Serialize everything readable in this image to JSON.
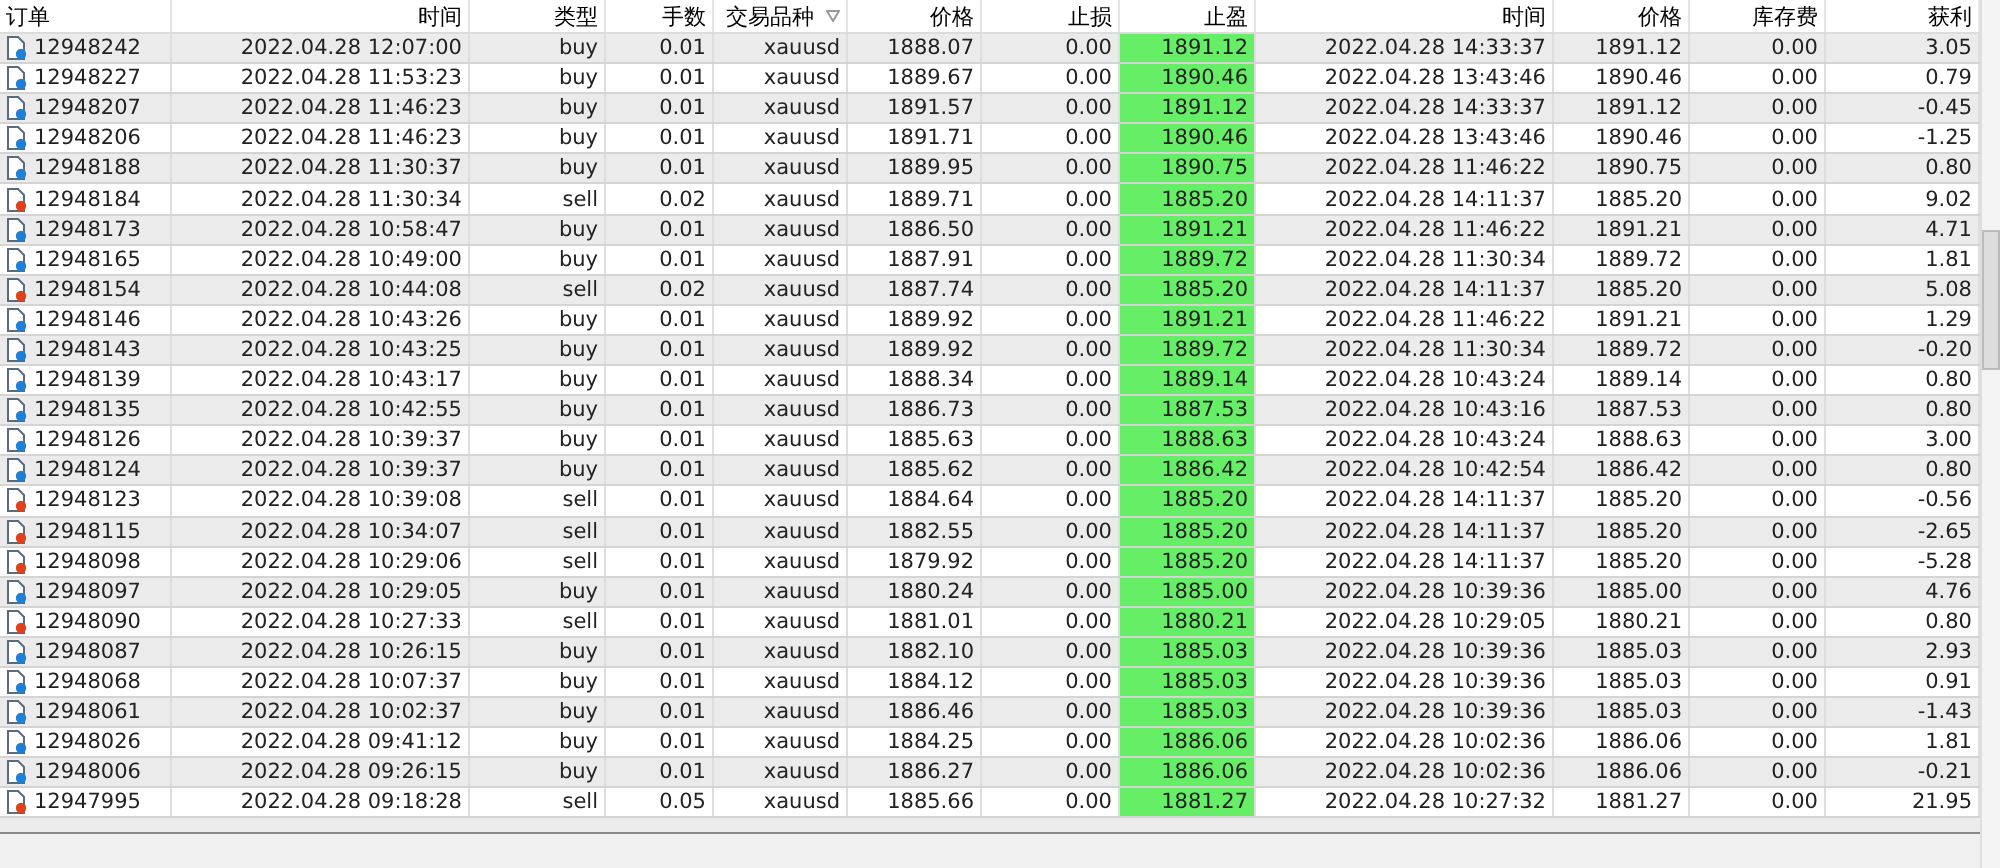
{
  "table": {
    "columns": [
      {
        "label": "订单",
        "sorted": false
      },
      {
        "label": "时间",
        "sorted": false
      },
      {
        "label": "类型",
        "sorted": false
      },
      {
        "label": "手数",
        "sorted": false
      },
      {
        "label": "交易品种",
        "sorted": true
      },
      {
        "label": "价格",
        "sorted": false
      },
      {
        "label": "止损",
        "sorted": false
      },
      {
        "label": "止盈",
        "sorted": false
      },
      {
        "label": "时间",
        "sorted": false
      },
      {
        "label": "价格",
        "sorted": false
      },
      {
        "label": "库存费",
        "sorted": false
      },
      {
        "label": "获利",
        "sorted": false
      }
    ],
    "rows": [
      {
        "kind": "buy",
        "cells": [
          "12948242",
          "2022.04.28 12:07:00",
          "buy",
          "0.01",
          "xauusd",
          "1888.07",
          "0.00",
          "1891.12",
          "2022.04.28 14:33:37",
          "1891.12",
          "0.00",
          "3.05"
        ]
      },
      {
        "kind": "buy",
        "cells": [
          "12948227",
          "2022.04.28 11:53:23",
          "buy",
          "0.01",
          "xauusd",
          "1889.67",
          "0.00",
          "1890.46",
          "2022.04.28 13:43:46",
          "1890.46",
          "0.00",
          "0.79"
        ]
      },
      {
        "kind": "buy",
        "cells": [
          "12948207",
          "2022.04.28 11:46:23",
          "buy",
          "0.01",
          "xauusd",
          "1891.57",
          "0.00",
          "1891.12",
          "2022.04.28 14:33:37",
          "1891.12",
          "0.00",
          "-0.45"
        ]
      },
      {
        "kind": "buy",
        "cells": [
          "12948206",
          "2022.04.28 11:46:23",
          "buy",
          "0.01",
          "xauusd",
          "1891.71",
          "0.00",
          "1890.46",
          "2022.04.28 13:43:46",
          "1890.46",
          "0.00",
          "-1.25"
        ]
      },
      {
        "kind": "buy",
        "cells": [
          "12948188",
          "2022.04.28 11:30:37",
          "buy",
          "0.01",
          "xauusd",
          "1889.95",
          "0.00",
          "1890.75",
          "2022.04.28 11:46:22",
          "1890.75",
          "0.00",
          "0.80"
        ]
      },
      {
        "kind": "sell",
        "cells": [
          "12948184",
          "2022.04.28 11:30:34",
          "sell",
          "0.02",
          "xauusd",
          "1889.71",
          "0.00",
          "1885.20",
          "2022.04.28 14:11:37",
          "1885.20",
          "0.00",
          "9.02"
        ]
      },
      {
        "kind": "buy",
        "cells": [
          "12948173",
          "2022.04.28 10:58:47",
          "buy",
          "0.01",
          "xauusd",
          "1886.50",
          "0.00",
          "1891.21",
          "2022.04.28 11:46:22",
          "1891.21",
          "0.00",
          "4.71"
        ]
      },
      {
        "kind": "buy",
        "cells": [
          "12948165",
          "2022.04.28 10:49:00",
          "buy",
          "0.01",
          "xauusd",
          "1887.91",
          "0.00",
          "1889.72",
          "2022.04.28 11:30:34",
          "1889.72",
          "0.00",
          "1.81"
        ]
      },
      {
        "kind": "sell",
        "cells": [
          "12948154",
          "2022.04.28 10:44:08",
          "sell",
          "0.02",
          "xauusd",
          "1887.74",
          "0.00",
          "1885.20",
          "2022.04.28 14:11:37",
          "1885.20",
          "0.00",
          "5.08"
        ]
      },
      {
        "kind": "buy",
        "cells": [
          "12948146",
          "2022.04.28 10:43:26",
          "buy",
          "0.01",
          "xauusd",
          "1889.92",
          "0.00",
          "1891.21",
          "2022.04.28 11:46:22",
          "1891.21",
          "0.00",
          "1.29"
        ]
      },
      {
        "kind": "buy",
        "cells": [
          "12948143",
          "2022.04.28 10:43:25",
          "buy",
          "0.01",
          "xauusd",
          "1889.92",
          "0.00",
          "1889.72",
          "2022.04.28 11:30:34",
          "1889.72",
          "0.00",
          "-0.20"
        ]
      },
      {
        "kind": "buy",
        "cells": [
          "12948139",
          "2022.04.28 10:43:17",
          "buy",
          "0.01",
          "xauusd",
          "1888.34",
          "0.00",
          "1889.14",
          "2022.04.28 10:43:24",
          "1889.14",
          "0.00",
          "0.80"
        ]
      },
      {
        "kind": "buy",
        "cells": [
          "12948135",
          "2022.04.28 10:42:55",
          "buy",
          "0.01",
          "xauusd",
          "1886.73",
          "0.00",
          "1887.53",
          "2022.04.28 10:43:16",
          "1887.53",
          "0.00",
          "0.80"
        ]
      },
      {
        "kind": "buy",
        "cells": [
          "12948126",
          "2022.04.28 10:39:37",
          "buy",
          "0.01",
          "xauusd",
          "1885.63",
          "0.00",
          "1888.63",
          "2022.04.28 10:43:24",
          "1888.63",
          "0.00",
          "3.00"
        ]
      },
      {
        "kind": "buy",
        "cells": [
          "12948124",
          "2022.04.28 10:39:37",
          "buy",
          "0.01",
          "xauusd",
          "1885.62",
          "0.00",
          "1886.42",
          "2022.04.28 10:42:54",
          "1886.42",
          "0.00",
          "0.80"
        ]
      },
      {
        "kind": "sell",
        "cells": [
          "12948123",
          "2022.04.28 10:39:08",
          "sell",
          "0.01",
          "xauusd",
          "1884.64",
          "0.00",
          "1885.20",
          "2022.04.28 14:11:37",
          "1885.20",
          "0.00",
          "-0.56"
        ]
      },
      {
        "kind": "sell",
        "cells": [
          "12948115",
          "2022.04.28 10:34:07",
          "sell",
          "0.01",
          "xauusd",
          "1882.55",
          "0.00",
          "1885.20",
          "2022.04.28 14:11:37",
          "1885.20",
          "0.00",
          "-2.65"
        ]
      },
      {
        "kind": "sell",
        "cells": [
          "12948098",
          "2022.04.28 10:29:06",
          "sell",
          "0.01",
          "xauusd",
          "1879.92",
          "0.00",
          "1885.20",
          "2022.04.28 14:11:37",
          "1885.20",
          "0.00",
          "-5.28"
        ]
      },
      {
        "kind": "buy",
        "cells": [
          "12948097",
          "2022.04.28 10:29:05",
          "buy",
          "0.01",
          "xauusd",
          "1880.24",
          "0.00",
          "1885.00",
          "2022.04.28 10:39:36",
          "1885.00",
          "0.00",
          "4.76"
        ]
      },
      {
        "kind": "sell",
        "cells": [
          "12948090",
          "2022.04.28 10:27:33",
          "sell",
          "0.01",
          "xauusd",
          "1881.01",
          "0.00",
          "1880.21",
          "2022.04.28 10:29:05",
          "1880.21",
          "0.00",
          "0.80"
        ]
      },
      {
        "kind": "buy",
        "cells": [
          "12948087",
          "2022.04.28 10:26:15",
          "buy",
          "0.01",
          "xauusd",
          "1882.10",
          "0.00",
          "1885.03",
          "2022.04.28 10:39:36",
          "1885.03",
          "0.00",
          "2.93"
        ]
      },
      {
        "kind": "buy",
        "cells": [
          "12948068",
          "2022.04.28 10:07:37",
          "buy",
          "0.01",
          "xauusd",
          "1884.12",
          "0.00",
          "1885.03",
          "2022.04.28 10:39:36",
          "1885.03",
          "0.00",
          "0.91"
        ]
      },
      {
        "kind": "buy",
        "cells": [
          "12948061",
          "2022.04.28 10:02:37",
          "buy",
          "0.01",
          "xauusd",
          "1886.46",
          "0.00",
          "1885.03",
          "2022.04.28 10:39:36",
          "1885.03",
          "0.00",
          "-1.43"
        ]
      },
      {
        "kind": "buy",
        "cells": [
          "12948026",
          "2022.04.28 09:41:12",
          "buy",
          "0.01",
          "xauusd",
          "1884.25",
          "0.00",
          "1886.06",
          "2022.04.28 10:02:36",
          "1886.06",
          "0.00",
          "1.81"
        ]
      },
      {
        "kind": "buy",
        "cells": [
          "12948006",
          "2022.04.28 09:26:15",
          "buy",
          "0.01",
          "xauusd",
          "1886.27",
          "0.00",
          "1886.06",
          "2022.04.28 10:02:36",
          "1886.06",
          "0.00",
          "-0.21"
        ]
      },
      {
        "kind": "sell",
        "cells": [
          "12947995",
          "2022.04.28 09:18:28",
          "sell",
          "0.05",
          "xauusd",
          "1885.66",
          "0.00",
          "1881.27",
          "2022.04.28 10:27:32",
          "1881.27",
          "0.00",
          "21.95"
        ]
      }
    ]
  }
}
